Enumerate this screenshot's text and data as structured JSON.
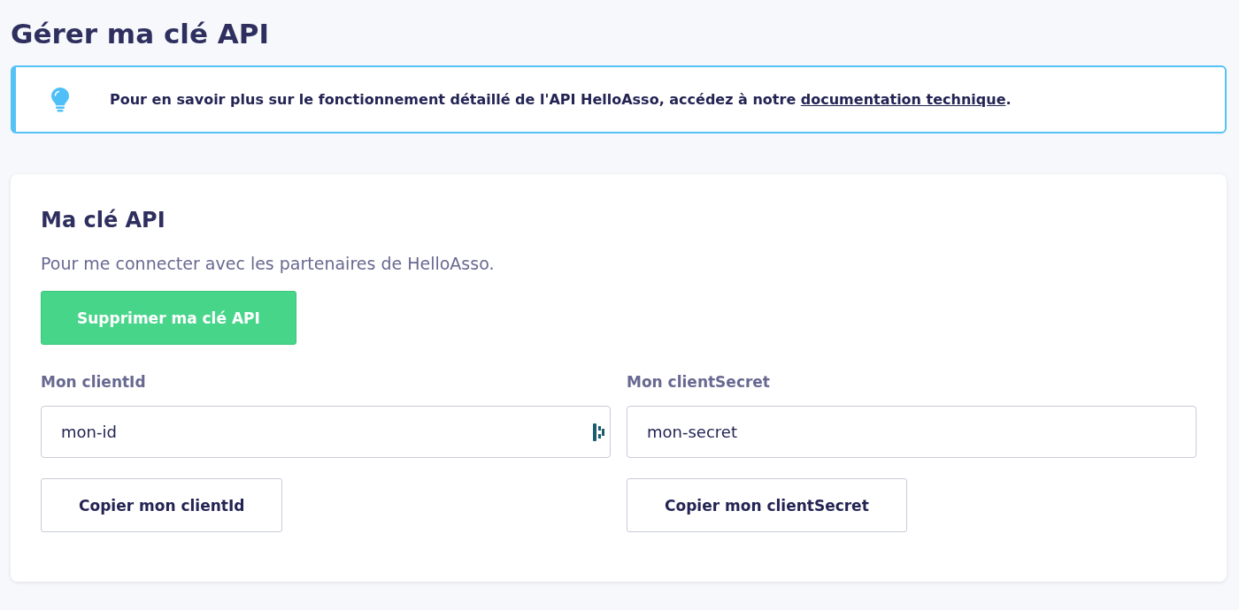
{
  "page_title": "Gérer ma clé API",
  "info": {
    "text_before": "Pour en savoir plus sur le fonctionnement détaillé de l'API HelloAsso, accédez à notre ",
    "link": "documentation technique",
    "text_after": "."
  },
  "card": {
    "title": "Ma clé API",
    "description": "Pour me connecter avec les partenaires de HelloAsso.",
    "delete_button": "Supprimer ma clé API",
    "fields": [
      {
        "label": "Mon clientId",
        "value": "mon-id",
        "password_manager_icon": true,
        "copy_button": "Copier mon clientId"
      },
      {
        "label": "Mon clientSecret",
        "value": "mon-secret",
        "password_manager_icon": false,
        "copy_button": "Copier mon clientSecret"
      }
    ]
  }
}
